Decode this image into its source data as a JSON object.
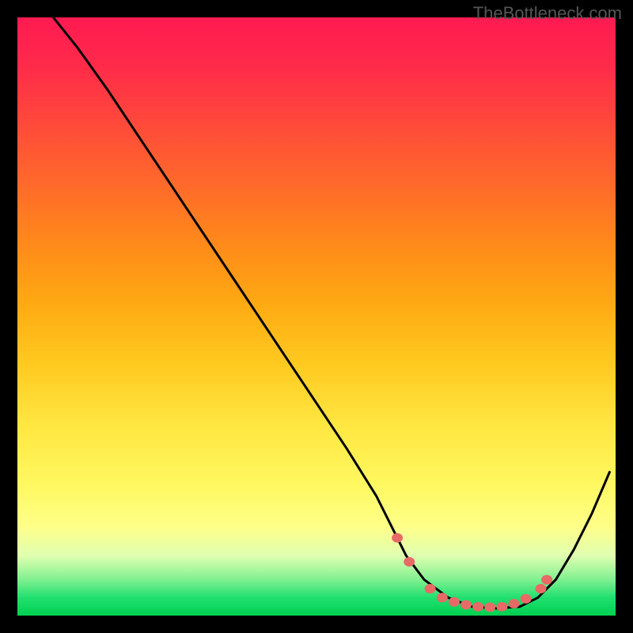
{
  "watermark": "TheBottleneck.com",
  "chart_data": {
    "type": "line",
    "title": "",
    "xlabel": "",
    "ylabel": "",
    "xlim": [
      0,
      100
    ],
    "ylim": [
      0,
      100
    ],
    "series": [
      {
        "name": "bottleneck-curve",
        "x": [
          6,
          10,
          15,
          20,
          25,
          30,
          35,
          40,
          45,
          50,
          55,
          60,
          63,
          65,
          68,
          72,
          76,
          80,
          84,
          87,
          90,
          93,
          96,
          99
        ],
        "y": [
          100,
          95,
          88,
          80.5,
          73,
          65.5,
          58,
          50.5,
          43,
          35.5,
          28,
          20,
          14,
          10,
          6,
          3,
          1.5,
          1.2,
          1.5,
          3,
          6,
          11,
          17,
          24
        ]
      }
    ],
    "markers": {
      "name": "optimal-range-dots",
      "color": "#e86a66",
      "points": [
        {
          "x": 63.5,
          "y": 13.0
        },
        {
          "x": 65.5,
          "y": 9.0
        },
        {
          "x": 69.0,
          "y": 4.5
        },
        {
          "x": 71.0,
          "y": 3.0
        },
        {
          "x": 73.0,
          "y": 2.3
        },
        {
          "x": 75.0,
          "y": 1.8
        },
        {
          "x": 77.0,
          "y": 1.5
        },
        {
          "x": 79.0,
          "y": 1.4
        },
        {
          "x": 81.0,
          "y": 1.5
        },
        {
          "x": 83.0,
          "y": 2.0
        },
        {
          "x": 85.0,
          "y": 2.8
        },
        {
          "x": 87.5,
          "y": 4.5
        },
        {
          "x": 88.5,
          "y": 6.0
        }
      ]
    },
    "gradient": {
      "orientation": "vertical",
      "stops": [
        {
          "pos": 0.0,
          "color": "#ff1a52"
        },
        {
          "pos": 0.5,
          "color": "#ffca20"
        },
        {
          "pos": 0.85,
          "color": "#ffff88"
        },
        {
          "pos": 1.0,
          "color": "#00d050"
        }
      ]
    }
  }
}
